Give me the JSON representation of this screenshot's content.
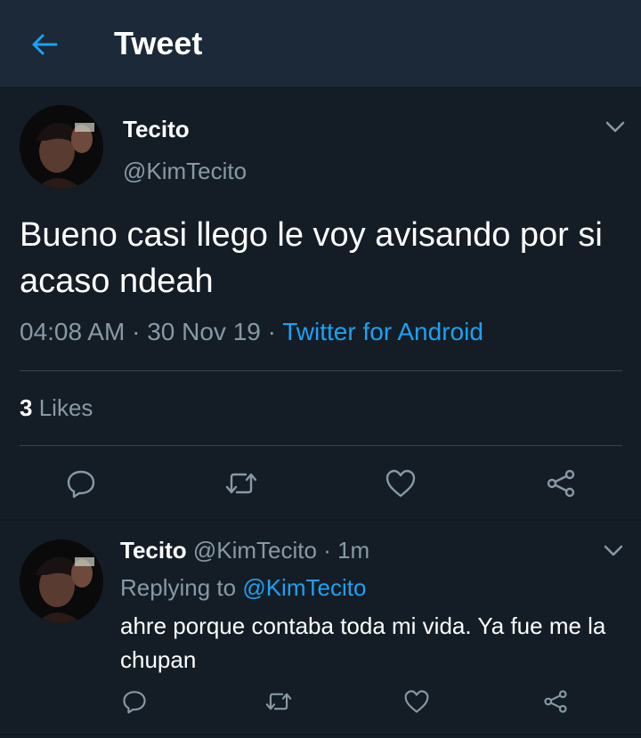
{
  "header": {
    "title": "Tweet"
  },
  "tweet": {
    "display_name": "Tecito",
    "handle": "@KimTecito",
    "text": "Bueno casi llego le voy avisando por si acaso ndeah",
    "time": "04:08 AM",
    "date": "30 Nov 19",
    "source": "Twitter for Android",
    "likes_count": "3",
    "likes_label": "Likes"
  },
  "reply": {
    "display_name": "Tecito",
    "handle": "@KimTecito",
    "age": "1m",
    "replying_prefix": "Replying to",
    "replying_to": "@KimTecito",
    "text": "ahre porque contaba toda mi vida. Ya fue me la chupan"
  },
  "colors": {
    "background": "#141d26",
    "header": "#1c2938",
    "accent": "#1da1f2",
    "muted": "#8899a6",
    "divider": "#38444d"
  },
  "icons": [
    "back-arrow-icon",
    "chevron-down-icon",
    "reply-icon",
    "retweet-icon",
    "like-icon",
    "share-icon"
  ]
}
